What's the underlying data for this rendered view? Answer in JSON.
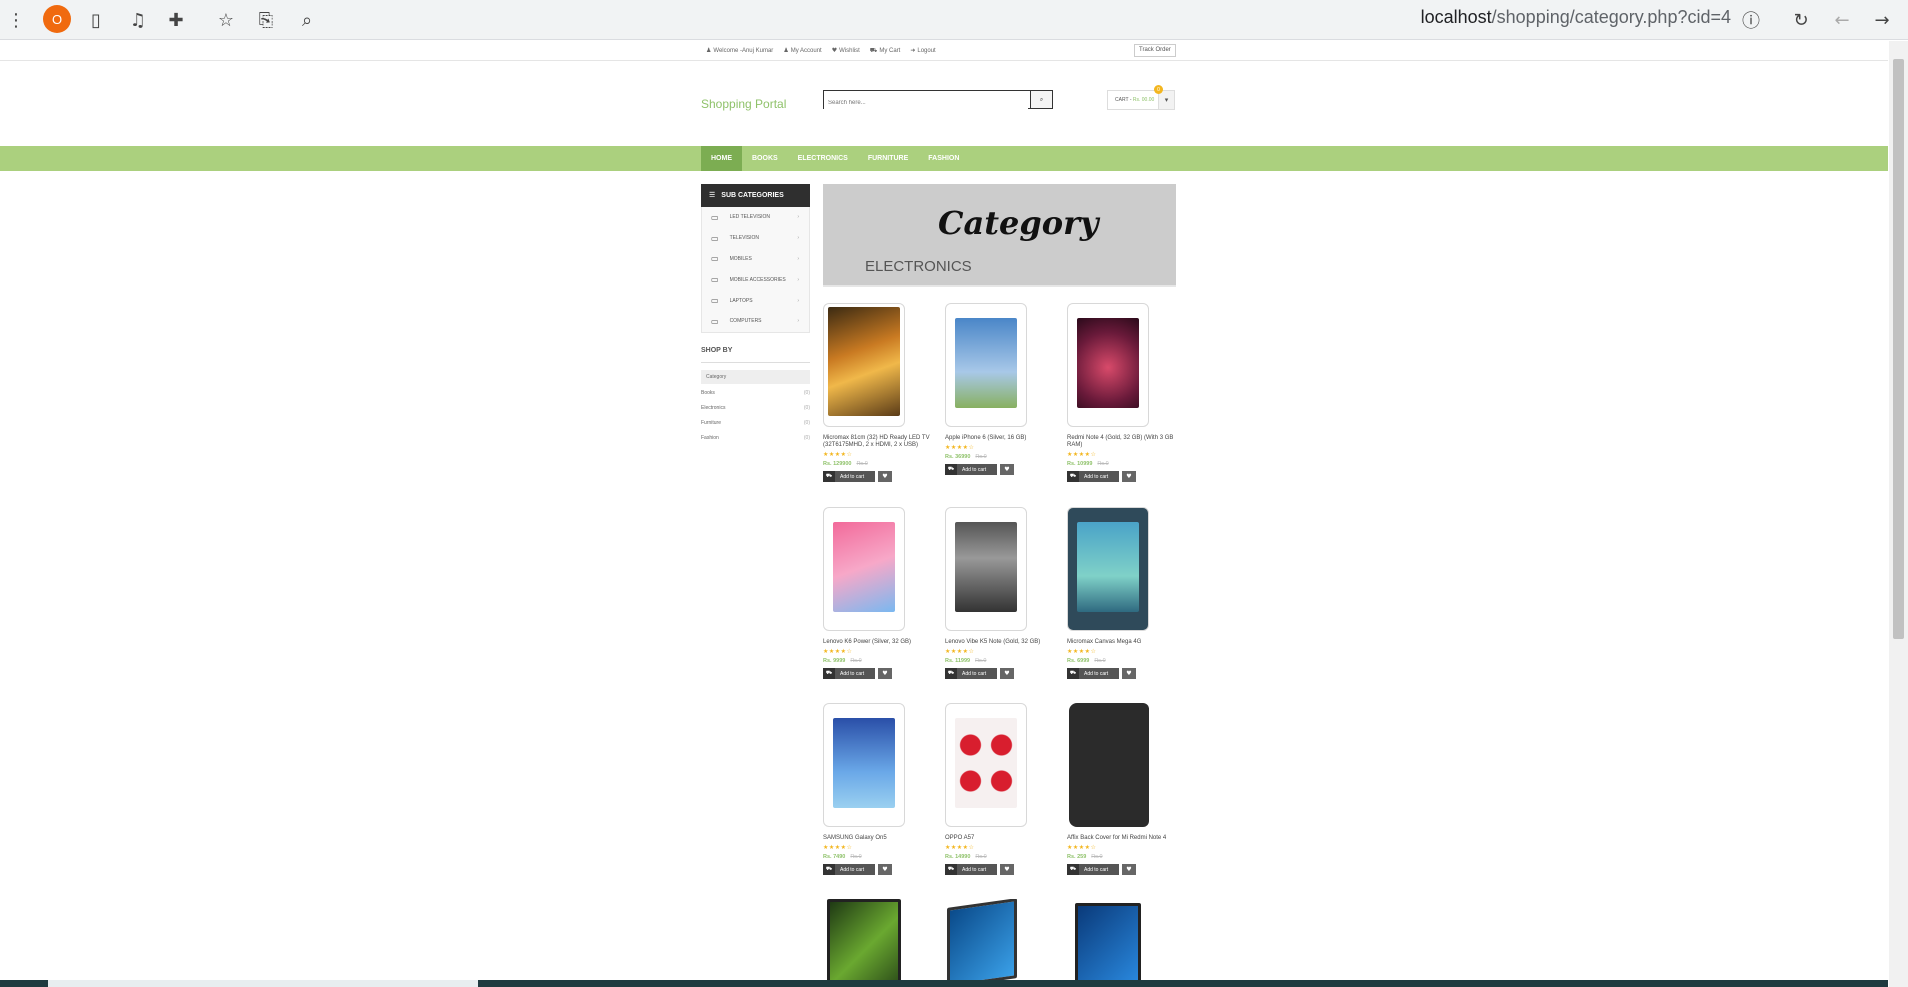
{
  "browser": {
    "profile_initial": "O",
    "url_host": "localhost",
    "url_path": "/shopping/category.php?cid=4"
  },
  "topbar": {
    "links": [
      "Welcome -Anuj Kumar",
      "My Account",
      "Wishlist",
      "My Cart",
      "Logout"
    ],
    "track_order": "Track Order"
  },
  "header": {
    "logo": "Shopping Portal",
    "search_placeholder": "Search here...",
    "cart_label": "CART -",
    "cart_amount": "Rs. 00.00",
    "cart_count": "0"
  },
  "nav": [
    "HOME",
    "BOOKS",
    "ELECTRONICS",
    "FURNITURE",
    "FASHION"
  ],
  "sidebar": {
    "subcat_title": "SUB CATEGORIES",
    "subcats": [
      "LED TELEVISION",
      "TELEVISION",
      "MOBILES",
      "MOBILE ACCESSORIES",
      "LAPTOPS",
      "COMPUTERS"
    ],
    "shopby": "SHOP BY",
    "category_label": "Category",
    "categories": [
      {
        "name": "Books",
        "count": "(0)"
      },
      {
        "name": "Electronics",
        "count": "(0)"
      },
      {
        "name": "Furniture",
        "count": "(0)"
      },
      {
        "name": "Fashion",
        "count": "(0)"
      }
    ]
  },
  "banner": {
    "script": "Category",
    "title": "ELECTRONICS"
  },
  "product_actions": {
    "add_to_cart": "Add to cart"
  },
  "products": [
    {
      "name": "Micromax 81cm (32) HD Ready LED TV (32T6175MHD, 2 x HDMI, 2 x USB)",
      "stars": "★★★★☆",
      "price": "Rs. 129900",
      "old": "Rs.0"
    },
    {
      "name": "Apple iPhone 6 (Silver, 16 GB)",
      "stars": "★★★★☆",
      "price": "Rs. 36990",
      "old": "Rs.0"
    },
    {
      "name": "Redmi Note 4 (Gold, 32 GB) (With 3 GB RAM)",
      "stars": "★★★★☆",
      "price": "Rs. 10999",
      "old": "Rs.0"
    },
    {
      "name": "Lenovo K6 Power (Silver, 32 GB)",
      "stars": "★★★★☆",
      "price": "Rs. 9999",
      "old": "Rs.0"
    },
    {
      "name": "Lenovo Vibe K5 Note (Gold, 32 GB)",
      "stars": "★★★★☆",
      "price": "Rs. 11999",
      "old": "Rs.0"
    },
    {
      "name": "Micromax Canvas Mega 4G",
      "stars": "★★★★☆",
      "price": "Rs. 6999",
      "old": "Rs.0"
    },
    {
      "name": "SAMSUNG Galaxy On5",
      "stars": "★★★★☆",
      "price": "Rs. 7490",
      "old": "Rs.0"
    },
    {
      "name": "OPPO A57",
      "stars": "★★★★☆",
      "price": "Rs. 14990",
      "old": "Rs.0"
    },
    {
      "name": "Affix Back Cover for Mi Redmi Note 4",
      "stars": "★★★★☆",
      "price": "Rs. 259",
      "old": "Rs.0"
    }
  ],
  "colors": {
    "accent": "#abd07e",
    "accent_dark": "#7cad52",
    "price": "#8fc26a"
  }
}
